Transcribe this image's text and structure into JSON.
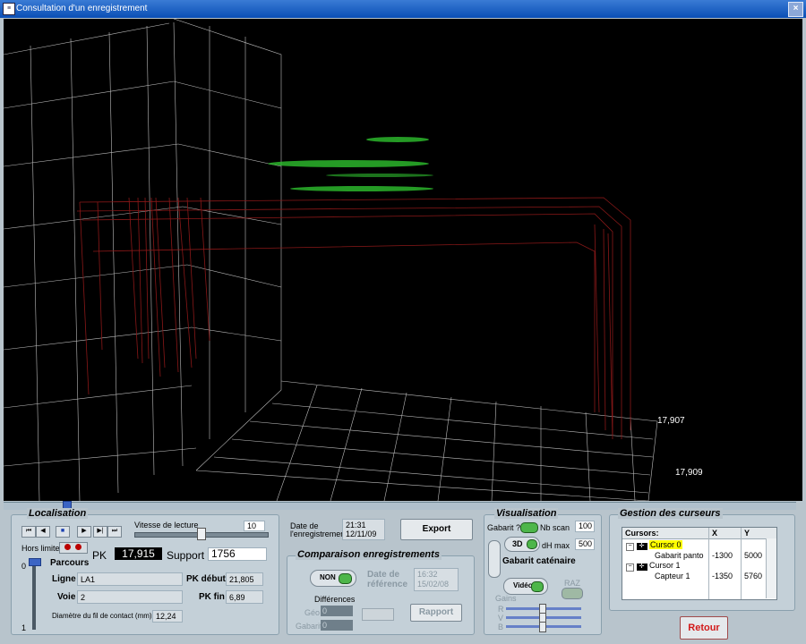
{
  "window": {
    "title": "Consultation d'un enregistrement",
    "close": "×",
    "icon": "≡"
  },
  "viewport": {
    "label_top": "17,907",
    "label_bottom": "17,909"
  },
  "localisation": {
    "title": "Localisation",
    "transport": [
      "⏮",
      "◀",
      "■",
      "▶",
      "▶|",
      "⏭"
    ],
    "speed_label": "Vitesse de lecture",
    "speed_value": "10",
    "hors_limite": "Hors limite",
    "pk_label": "PK",
    "pk_value": "17,915",
    "support_label": "Support",
    "support_value": "1756",
    "slider_top": "0",
    "slider_bottom": "1",
    "parcours_label": "Parcours",
    "ligne_label": "Ligne",
    "ligne_value": "LA1",
    "voie_label": "Voie",
    "voie_value": "2",
    "pk_debut_label": "PK début",
    "pk_debut_value": "21,805",
    "pk_fin_label": "PK fin",
    "pk_fin_value": "6,89",
    "diam_label": "Diamètre du fil de contact (mm)",
    "diam_value": "12,24"
  },
  "middle": {
    "date_label_1": "Date de",
    "date_label_2": "l'enregistrement",
    "date_value_1": "21:31",
    "date_value_2": "12/11/09",
    "export": "Export",
    "comparaison_title": "Comparaison enregistrements",
    "non": "NON",
    "date_ref_1": "Date de",
    "date_ref_2": "référence",
    "date_ref_value_1": "16:32",
    "date_ref_value_2": "15/02/08",
    "differences": "Différences",
    "geo": "Géo",
    "gabarit": "Gabarit",
    "geo_value": "0",
    "gabarit_value": "0",
    "rapport": "Rapport"
  },
  "visualisation": {
    "title": "Visualisation",
    "gabarit_q": "Gabarit ?",
    "nb_scan_label": "Nb scan",
    "nb_scan_value": "100",
    "btn_3d": "3D",
    "dh_max_label": "dH max",
    "dh_max_value": "500",
    "gabarit_catenaire": "Gabarit caténaire",
    "video": "Vidéo",
    "raz": "RAZ",
    "gains": "Gains",
    "r": "R",
    "v": "V",
    "b": "B"
  },
  "curseurs": {
    "title": "Gestion des curseurs",
    "headers": [
      "Cursors:",
      "X",
      "Y"
    ],
    "rows": [
      {
        "name": "Cursor 0",
        "x": "",
        "y": ""
      },
      {
        "name": "Gabarit panto",
        "x": "-1300",
        "y": "5000"
      },
      {
        "name": "Cursor 1",
        "x": "",
        "y": ""
      },
      {
        "name": "Capteur 1",
        "x": "-1350",
        "y": "5760"
      }
    ]
  },
  "retour": "Retour",
  "colors": {
    "titlebar": "#0a4fb5",
    "grid": "#c9c9c9",
    "structure": "#7a1414",
    "points": "#2ec02e",
    "retour_text": "#d21a1a",
    "highlight": "#ffff00"
  }
}
